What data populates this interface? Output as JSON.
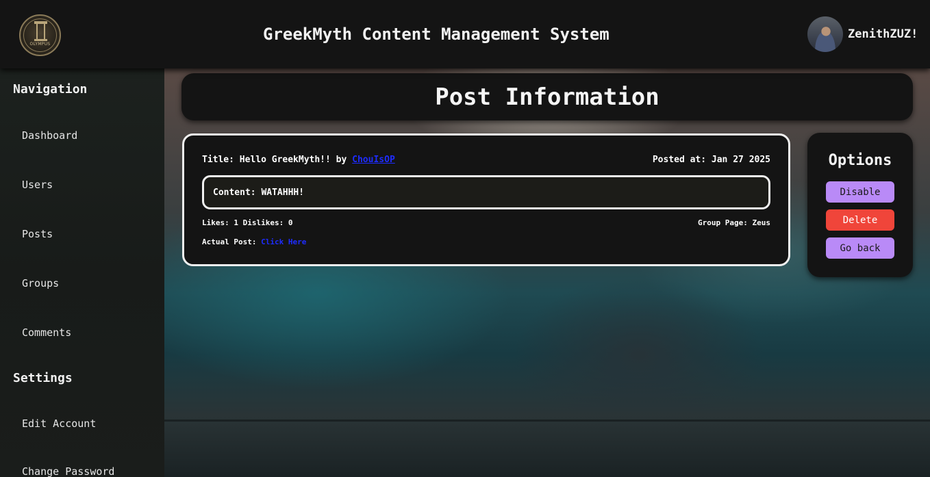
{
  "header": {
    "logo_text": "OLYMPUS",
    "app_title": "GreekMyth Content Management System",
    "username": "ZenithZUZ!"
  },
  "sidebar": {
    "navigation_heading": "Navigation",
    "nav_items": [
      {
        "label": "Dashboard"
      },
      {
        "label": "Users"
      },
      {
        "label": "Posts"
      },
      {
        "label": "Groups"
      },
      {
        "label": "Comments"
      }
    ],
    "settings_heading": "Settings",
    "settings_items": [
      {
        "label": "Edit Account"
      },
      {
        "label": "Change Password"
      }
    ]
  },
  "page": {
    "title": "Post Information"
  },
  "post": {
    "title_prefix": "Title: Hello GreekMyth!! by",
    "author": "ChouIsOP",
    "posted_at": "Posted at: Jan 27 2025",
    "content": "Content: WATAHHH!",
    "stats": "Likes: 1 Dislikes: 0",
    "group_page": "Group Page: Zeus",
    "actual_post_label": "Actual Post:",
    "actual_post_link": "Click Here"
  },
  "options": {
    "heading": "Options",
    "disable_label": "Disable",
    "delete_label": "Delete",
    "back_label": "Go back"
  },
  "colors": {
    "header_bg": "#141414",
    "link": "#1e2cff",
    "disable_button": "#b98af7",
    "delete_button": "#f0453a",
    "back_button": "#b98af7"
  }
}
